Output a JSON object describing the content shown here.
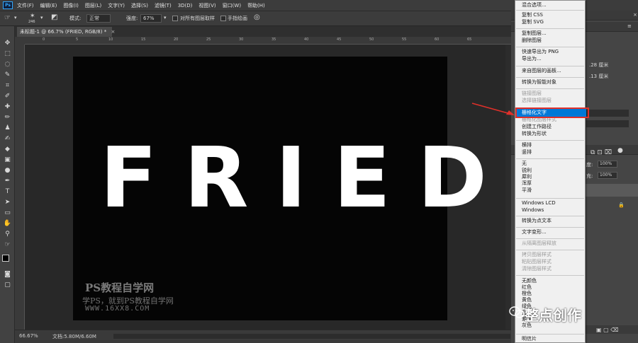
{
  "menubar": {
    "logo": "Ps",
    "items": [
      "文件(F)",
      "编辑(E)",
      "图像(I)",
      "图层(L)",
      "文字(Y)",
      "选择(S)",
      "滤镜(T)",
      "3D(D)",
      "视图(V)",
      "窗口(W)",
      "帮助(H)"
    ]
  },
  "options": {
    "brush_size": "246",
    "mode_label": "模式:",
    "mode_value": "正常",
    "strength_label": "强度:",
    "strength_value": "67%",
    "sample_all": "对所有图层取样",
    "finger_paint": "手指绘画"
  },
  "document": {
    "tab_title": "未标题-1 @ 66.7% (FRIED, RGB/8) *",
    "close": "×",
    "canvas_text": "FRIED",
    "ruler_top": [
      "0",
      "5",
      "10",
      "15",
      "20",
      "25",
      "30",
      "35",
      "40",
      "45",
      "50",
      "55",
      "60",
      "65"
    ]
  },
  "watermark": {
    "line1": "PS教程自学网",
    "line2": "学PS，就到PS教程自学网",
    "line3": "WWW.16XX8.COM"
  },
  "status": {
    "zoom": "66.67%",
    "doc": "文档:5.80M/6.60M"
  },
  "right_panel": {
    "value1": ".28 厘米",
    "value2": ".13 厘米",
    "opacity_label": "度:",
    "opacity_value": "100%",
    "fill_label": "充:",
    "fill_value": "100%"
  },
  "context_menu": {
    "items": [
      {
        "label": "混合选项...",
        "disabled": false
      },
      {
        "label": "复制 CSS",
        "disabled": false
      },
      {
        "label": "复制 SVG",
        "disabled": false
      },
      {
        "label": "复制图层...",
        "disabled": false
      },
      {
        "label": "删除图层",
        "disabled": false
      },
      {
        "label": "快速导出为 PNG",
        "disabled": false
      },
      {
        "label": "导出为...",
        "disabled": false
      },
      {
        "label": "来自图层的画板...",
        "disabled": false
      },
      {
        "label": "转换为智能对象",
        "disabled": false
      },
      {
        "label": "链接图层",
        "disabled": true
      },
      {
        "label": "选择链接图层",
        "disabled": true
      },
      {
        "label": "栅格化文字",
        "disabled": false,
        "highlighted": true
      },
      {
        "label": "栅格化图层样式",
        "disabled": true
      },
      {
        "label": "创建工作路径",
        "disabled": false
      },
      {
        "label": "转换为形状",
        "disabled": false
      },
      {
        "label": "横排",
        "disabled": false
      },
      {
        "label": "竖排",
        "disabled": false
      },
      {
        "label": "无",
        "disabled": false
      },
      {
        "label": "锐利",
        "disabled": false
      },
      {
        "label": "犀利",
        "disabled": false
      },
      {
        "label": "浑厚",
        "disabled": false
      },
      {
        "label": "平滑",
        "disabled": false
      },
      {
        "label": "Windows LCD",
        "disabled": false
      },
      {
        "label": "Windows",
        "disabled": false
      },
      {
        "label": "转换为点文本",
        "disabled": false
      },
      {
        "label": "文字变形...",
        "disabled": false
      },
      {
        "label": "从隔离图层释放",
        "disabled": true
      },
      {
        "label": "拷贝图层样式",
        "disabled": true
      },
      {
        "label": "粘贴图层样式",
        "disabled": true
      },
      {
        "label": "清除图层样式",
        "disabled": true
      },
      {
        "label": "无颜色",
        "disabled": false
      },
      {
        "label": "红色",
        "disabled": false
      },
      {
        "label": "橙色",
        "disabled": false
      },
      {
        "label": "黄色",
        "disabled": false
      },
      {
        "label": "绿色",
        "disabled": false
      },
      {
        "label": "蓝色",
        "disabled": false
      },
      {
        "label": "紫色",
        "disabled": false
      },
      {
        "label": "灰色",
        "disabled": false
      },
      {
        "label": "明信片",
        "disabled": false
      }
    ]
  },
  "brand": {
    "wechat_name": "整点创作"
  },
  "colors": {
    "highlight": "#0078d7",
    "annotation_red": "#e0302a",
    "canvas_bg": "#050505",
    "ps_blue": "#31a8ff"
  }
}
